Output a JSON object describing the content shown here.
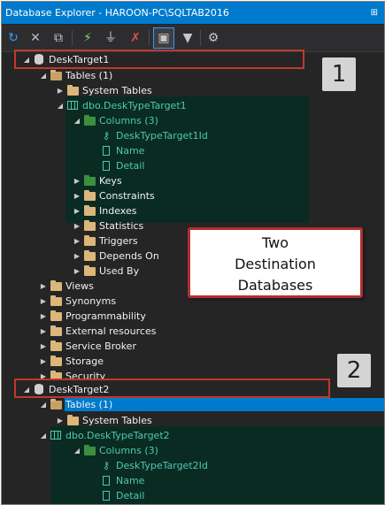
{
  "window": {
    "title": "Database Explorer - HAROON-PC\\SQLTAB2016",
    "pin_glyph": "⊞"
  },
  "toolbar": {
    "icons": [
      "refresh-icon",
      "disconnect-icon",
      "collapse-icon",
      "new-connection-icon",
      "connect-icon",
      "remove-connection-icon",
      "select-icon",
      "filter-icon",
      "settings-icon"
    ]
  },
  "tree": {
    "db1": {
      "name": "DeskTarget1",
      "tables": "Tables (1)",
      "system_tables": "System Tables",
      "table": "dbo.DeskTypeTarget1",
      "columns": "Columns (3)",
      "col_id": "DeskTypeTarget1Id",
      "col_name": "Name",
      "col_detail": "Detail",
      "keys": "Keys",
      "constraints": "Constraints",
      "indexes": "Indexes",
      "statistics": "Statistics",
      "triggers": "Triggers",
      "depends_on": "Depends On",
      "used_by": "Used By",
      "views": "Views",
      "synonyms": "Synonyms",
      "programmability": "Programmability",
      "external": "External resources",
      "service_broker": "Service Broker",
      "storage": "Storage",
      "security": "Security"
    },
    "db2": {
      "name": "DeskTarget2",
      "tables": "Tables (1)",
      "system_tables": "System Tables",
      "table": "dbo.DeskTypeTarget2",
      "columns": "Columns (3)",
      "col_id": "DeskTypeTarget2Id",
      "col_name": "Name",
      "col_detail": "Detail"
    }
  },
  "annotations": {
    "badge1": "1",
    "badge2": "2",
    "callout_line1": "Two",
    "callout_line2": "Destination",
    "callout_line3": "Databases"
  }
}
